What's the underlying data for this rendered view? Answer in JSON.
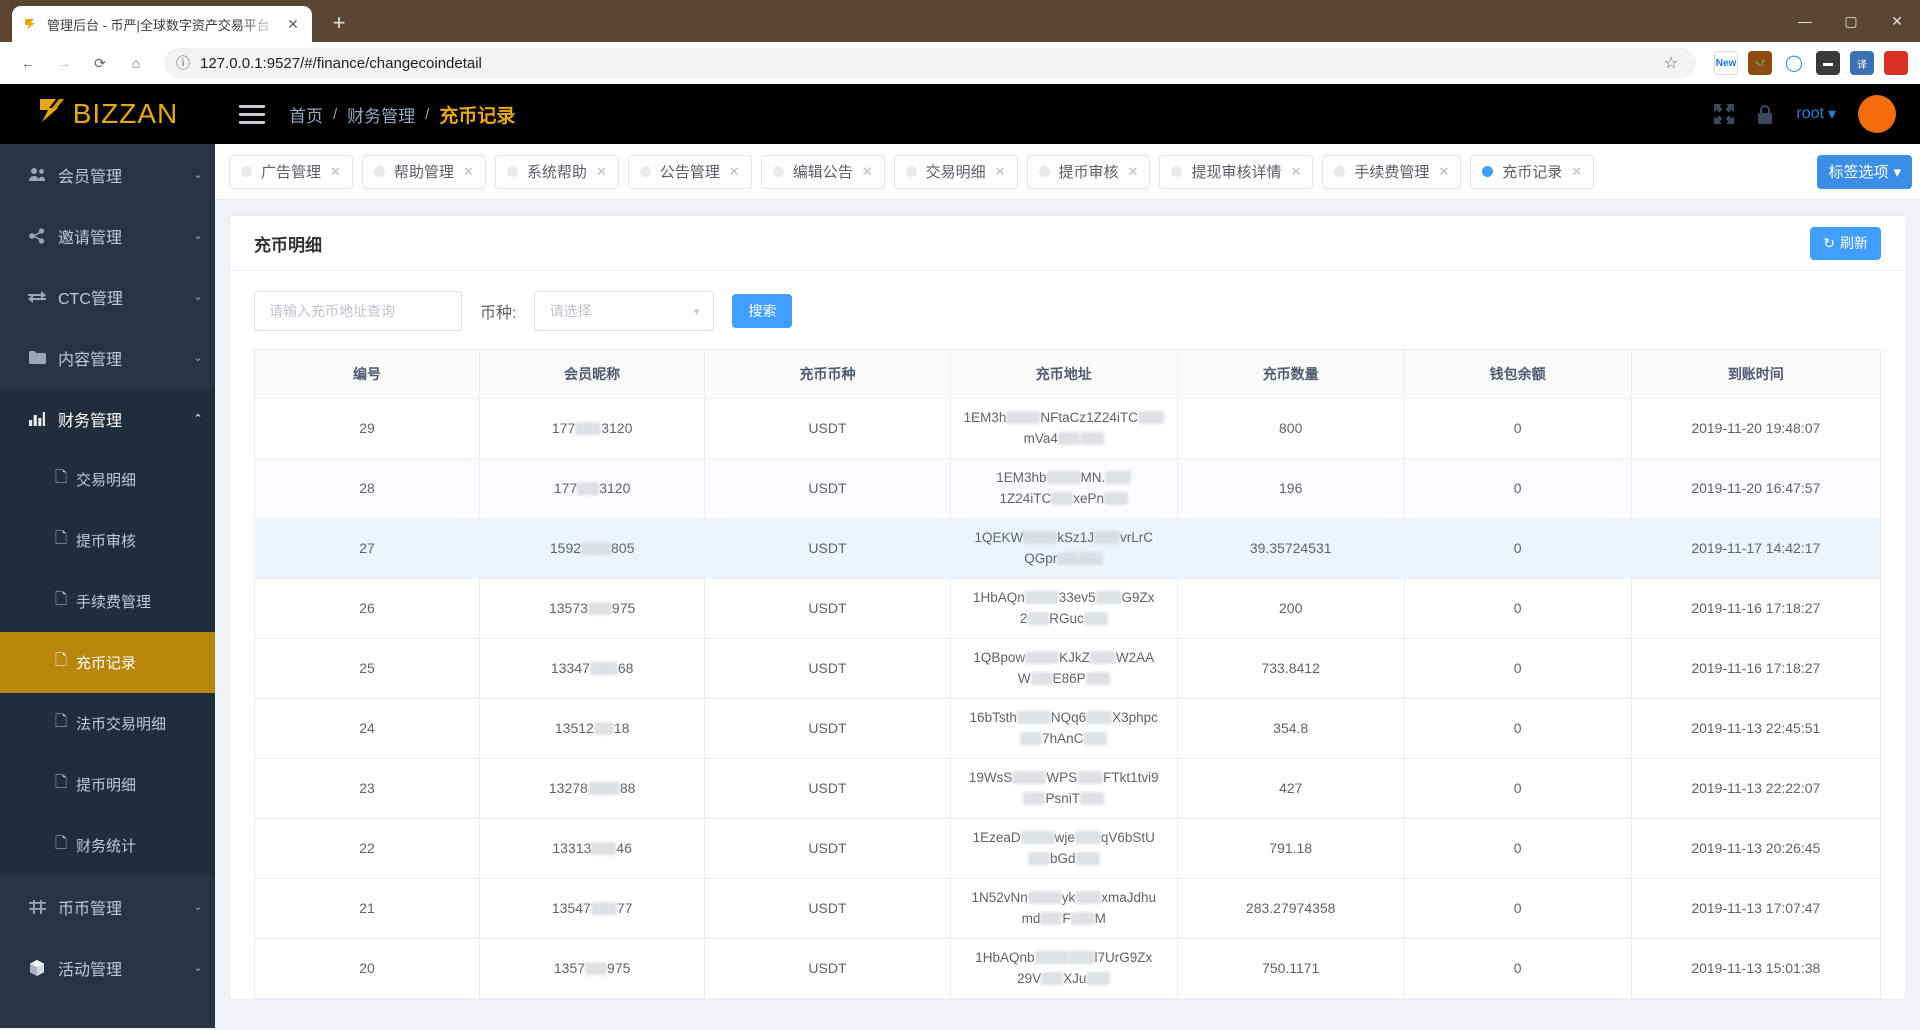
{
  "browser": {
    "tab_title": "管理后台 - 币严|全球数字资产交易平台",
    "tab_close": "✕",
    "new_tab": "+",
    "back_icon": "←",
    "forward_icon": "→",
    "reload_icon": "⟳",
    "home_icon": "⌂",
    "info_icon": "ⓘ",
    "url": "127.0.0.1:9527/#/finance/changecoindetail",
    "star_icon": "☆",
    "minimize": "—",
    "maximize": "▢",
    "close": "✕",
    "extensions": [
      {
        "name": "new-badge-extension",
        "label": "New",
        "color": "#4a90d9"
      },
      {
        "name": "butterfly-extension",
        "label": "🦋",
        "color": "#8e4b10"
      },
      {
        "name": "circle-extension",
        "label": "◯",
        "color": "#1e90ff"
      },
      {
        "name": "pocket-extension",
        "label": "▬",
        "color": "#3a3a3a"
      },
      {
        "name": "translate-extension",
        "label": "译",
        "color": "#3d6fb5"
      },
      {
        "name": "profile-avatar",
        "label": "●",
        "color": "#d93025"
      }
    ]
  },
  "sidebar": {
    "logo_mark": "⚡",
    "logo_text": "BIZZAN",
    "items": [
      {
        "label": "会员管理",
        "icon": "users-icon",
        "arrow": "⌄",
        "expanded": false
      },
      {
        "label": "邀请管理",
        "icon": "share-icon",
        "arrow": "⌄",
        "expanded": false
      },
      {
        "label": "CTC管理",
        "icon": "exchange-icon",
        "arrow": "⌄",
        "expanded": false
      },
      {
        "label": "内容管理",
        "icon": "folder-icon",
        "arrow": "⌄",
        "expanded": false
      },
      {
        "label": "财务管理",
        "icon": "chart-icon",
        "arrow": "⌃",
        "expanded": true
      },
      {
        "label": "币币管理",
        "icon": "coin-icon",
        "arrow": "⌄",
        "expanded": false
      },
      {
        "label": "活动管理",
        "icon": "box-icon",
        "arrow": "⌄",
        "expanded": false
      }
    ],
    "finance_children": [
      {
        "label": "交易明细",
        "active": false
      },
      {
        "label": "提币审核",
        "active": false
      },
      {
        "label": "手续费管理",
        "active": false
      },
      {
        "label": "充币记录",
        "active": true
      },
      {
        "label": "法币交易明细",
        "active": false
      },
      {
        "label": "提币明细",
        "active": false
      },
      {
        "label": "财务统计",
        "active": false
      }
    ],
    "doc_icon": "🗋"
  },
  "topbar": {
    "menu_icon": "hamburger-icon",
    "breadcrumb": [
      "首页",
      "财务管理",
      "充币记录"
    ],
    "separator": "/",
    "fullscreen_icon": "fullscreen-icon",
    "lock_icon": "lock-icon",
    "username": "root",
    "caret": "▾"
  },
  "tags": [
    {
      "label": "广告管理",
      "active": false,
      "close": "✕"
    },
    {
      "label": "帮助管理",
      "active": false,
      "close": "✕"
    },
    {
      "label": "系统帮助",
      "active": false,
      "close": "✕"
    },
    {
      "label": "公告管理",
      "active": false,
      "close": "✕"
    },
    {
      "label": "编辑公告",
      "active": false,
      "close": "✕"
    },
    {
      "label": "交易明细",
      "active": false,
      "close": "✕"
    },
    {
      "label": "提币审核",
      "active": false,
      "close": "✕"
    },
    {
      "label": "提现审核详情",
      "active": false,
      "close": "✕"
    },
    {
      "label": "手续费管理",
      "active": false,
      "close": "✕"
    },
    {
      "label": "充币记录",
      "active": true,
      "close": "✕"
    }
  ],
  "tag_options": {
    "label": "标签选项",
    "caret": "▾"
  },
  "card": {
    "title": "充币明细",
    "refresh_label": "刷新",
    "refresh_icon": "↻"
  },
  "filters": {
    "address_placeholder": "请输入充币地址查询",
    "address_value": "",
    "coin_label": "币种:",
    "coin_placeholder": "请选择",
    "coin_value": "",
    "coin_caret": "▾",
    "search_label": "搜索"
  },
  "table": {
    "columns": [
      "编号",
      "会员昵称",
      "充币币种",
      "充币地址",
      "充币数量",
      "钱包余额",
      "到账时间"
    ],
    "rows": [
      {
        "id": "29",
        "nick_a": "177",
        "nick_b": "3120",
        "coin": "USDT",
        "addr_1a": "1EM3h",
        "addr_1b": "NFtaCz1Z24iTC",
        "addr_2a": "",
        "addr_2b": "mVa4",
        "amount": "800",
        "balance": "0",
        "time": "2019-11-20 19:48:07",
        "row_style": ""
      },
      {
        "id": "28",
        "nick_a": "177",
        "nick_b": "3120",
        "coin": "USDT",
        "addr_1a": "1EM3hb",
        "addr_1b": "MN.",
        "addr_2a": "",
        "addr_2b": "1Z24iTC",
        "addr_3": "xePn",
        "amount": "196",
        "balance": "0",
        "time": "2019-11-20 16:47:57",
        "row_style": "stripe"
      },
      {
        "id": "27",
        "nick_a": "1592",
        "nick_b": "805",
        "coin": "USDT",
        "addr_1a": "1QEKW",
        "addr_1b": "kSz1J",
        "addr_2a": "vrLrC",
        "addr_2b": "QGpr",
        "amount": "39.35724531",
        "balance": "0",
        "time": "2019-11-17 14:42:17",
        "row_style": "hl"
      },
      {
        "id": "26",
        "nick_a": "13573",
        "nick_b": "975",
        "coin": "USDT",
        "addr_1a": "1HbAQn",
        "addr_1b": "33ev5",
        "addr_2a": "G9Zx",
        "addr_2b": "2",
        "addr_3": "RGuc",
        "amount": "200",
        "balance": "0",
        "time": "2019-11-16 17:18:27",
        "row_style": ""
      },
      {
        "id": "25",
        "nick_a": "13347",
        "nick_b": "68",
        "coin": "USDT",
        "addr_1a": "1QBpow",
        "addr_1b": "KJkZ",
        "addr_2a": "W2AA",
        "addr_2b": "W",
        "addr_3": "E86P",
        "amount": "733.8412",
        "balance": "0",
        "time": "2019-11-16 17:18:27",
        "row_style": ""
      },
      {
        "id": "24",
        "nick_a": "13512",
        "nick_b": "18",
        "coin": "USDT",
        "addr_1a": "16bTsth",
        "addr_1b": "NQq6",
        "addr_2a": "X3phpc",
        "addr_2b": "",
        "addr_3": "7hAnC",
        "amount": "354.8",
        "balance": "0",
        "time": "2019-11-13 22:45:51",
        "row_style": ""
      },
      {
        "id": "23",
        "nick_a": "13278",
        "nick_b": "88",
        "coin": "USDT",
        "addr_1a": "19WsS",
        "addr_1b": "WPS",
        "addr_2a": "FTkt1tvi9",
        "addr_2b": "",
        "addr_3": "PsniT",
        "amount": "427",
        "balance": "0",
        "time": "2019-11-13 22:22:07",
        "row_style": ""
      },
      {
        "id": "22",
        "nick_a": "13313",
        "nick_b": "46",
        "coin": "USDT",
        "addr_1a": "1EzeaD",
        "addr_1b": "wje",
        "addr_2a": "qV6bStU",
        "addr_2b": "",
        "addr_3": "bGd",
        "amount": "791.18",
        "balance": "0",
        "time": "2019-11-13 20:26:45",
        "row_style": ""
      },
      {
        "id": "21",
        "nick_a": "13547",
        "nick_b": "77",
        "coin": "USDT",
        "addr_1a": "1N52vNn",
        "addr_1b": "yk",
        "addr_2a": "xmaJdhu",
        "addr_2b": "md",
        "addr_3": "F",
        "addr_4": "M",
        "amount": "283.27974358",
        "balance": "0",
        "time": "2019-11-13 17:07:47",
        "row_style": ""
      },
      {
        "id": "20",
        "nick_a": "1357",
        "nick_b": "975",
        "coin": "USDT",
        "addr_1a": "1HbAQnb",
        "addr_1b": "",
        "addr_2a": "l7UrG9Zx",
        "addr_2b": "29V",
        "addr_3": "XJu",
        "amount": "750.1171",
        "balance": "0",
        "time": "2019-11-13 15:01:38",
        "row_style": ""
      }
    ]
  },
  "colors": {
    "brand_gold": "#e6a817",
    "active_gold": "#b8860b",
    "primary_blue": "#409eff",
    "sidebar_bg": "#263445",
    "submenu_bg": "#1f2d3d",
    "avatar_orange": "#f26c0d"
  }
}
